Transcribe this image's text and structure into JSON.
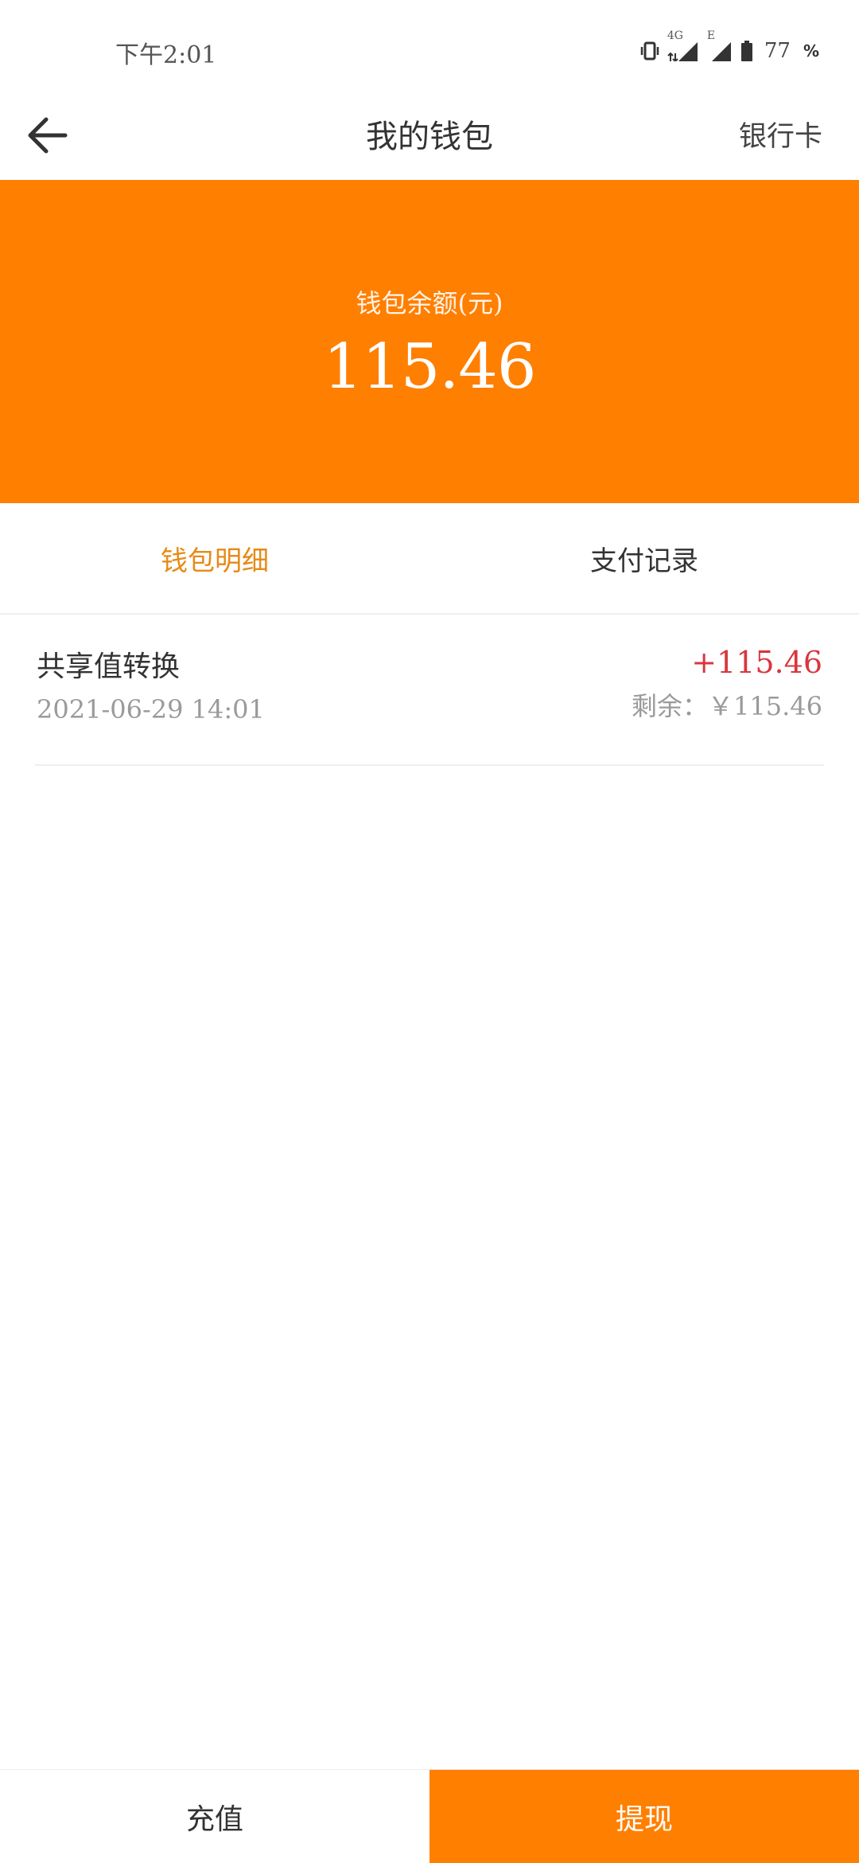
{
  "status_bar": {
    "time": "下午2:01",
    "network_1": "4G",
    "network_2": "E",
    "battery": "77",
    "battery_unit": "%"
  },
  "nav": {
    "title": "我的钱包",
    "right_label": "银行卡",
    "back_icon": "arrow-left-icon"
  },
  "balance": {
    "label": "钱包余额(元)",
    "amount": "115.46"
  },
  "tabs": [
    {
      "label": "钱包明细",
      "active": true
    },
    {
      "label": "支付记录",
      "active": false
    }
  ],
  "transactions": [
    {
      "title": "共享值转换",
      "datetime": "2021-06-29 14:01",
      "amount": "+115.46",
      "balance": "剩余：￥115.46"
    }
  ],
  "bottom": {
    "recharge_label": "充值",
    "withdraw_label": "提现"
  },
  "colors": {
    "accent": "#ff7f00",
    "active_tab": "#e68a17",
    "amount_positive": "#d9363e"
  }
}
